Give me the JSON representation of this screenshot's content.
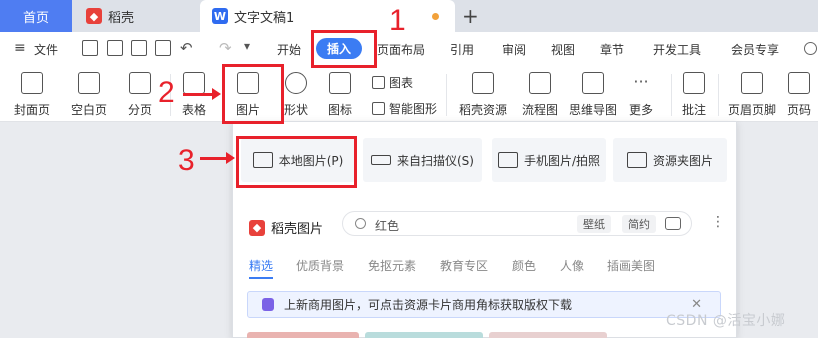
{
  "tabs": {
    "home": "首页",
    "daoke": "稻壳",
    "doc_title": "文字文稿1",
    "add": "+"
  },
  "menu": {
    "file": "文件",
    "items": [
      "开始",
      "插入",
      "页面布局",
      "引用",
      "审阅",
      "视图",
      "章节",
      "开发工具",
      "会员专享"
    ]
  },
  "ribbon": {
    "cover_page": "封面页",
    "blank_page": "空白页",
    "page_break": "分页",
    "table": "表格",
    "picture": "图片",
    "shape": "形状",
    "icon": "图标",
    "chart": "图表",
    "smart_art": "智能图形",
    "daoke_resources": "稻壳资源",
    "flowchart": "流程图",
    "mindmap": "思维导图",
    "more": "更多",
    "comment": "批注",
    "header_footer": "页眉页脚",
    "page_number": "页码"
  },
  "panel": {
    "local_picture": "本地图片(P)",
    "from_scanner": "来自扫描仪(S)",
    "phone_picture": "手机图片/拍照",
    "resource_picture": "资源夹图片",
    "daoke_picture": "稻壳图片",
    "search_value": "红色",
    "chip_wallpaper": "壁纸",
    "chip_simple": "简约",
    "categories": [
      "精选",
      "优质背景",
      "免抠元素",
      "教育专区",
      "颜色",
      "人像",
      "插画美图"
    ],
    "notice": "上新商用图片，可点击资源卡片商用角标获取版权下载"
  },
  "annotations": {
    "step1": "1",
    "step2": "2",
    "step3": "3",
    "watermark": "CSDN @活宝小娜"
  },
  "colors": {
    "accent": "#3b7cf3",
    "annotation": "#e8212b",
    "home_tab": "#4f7df2"
  }
}
